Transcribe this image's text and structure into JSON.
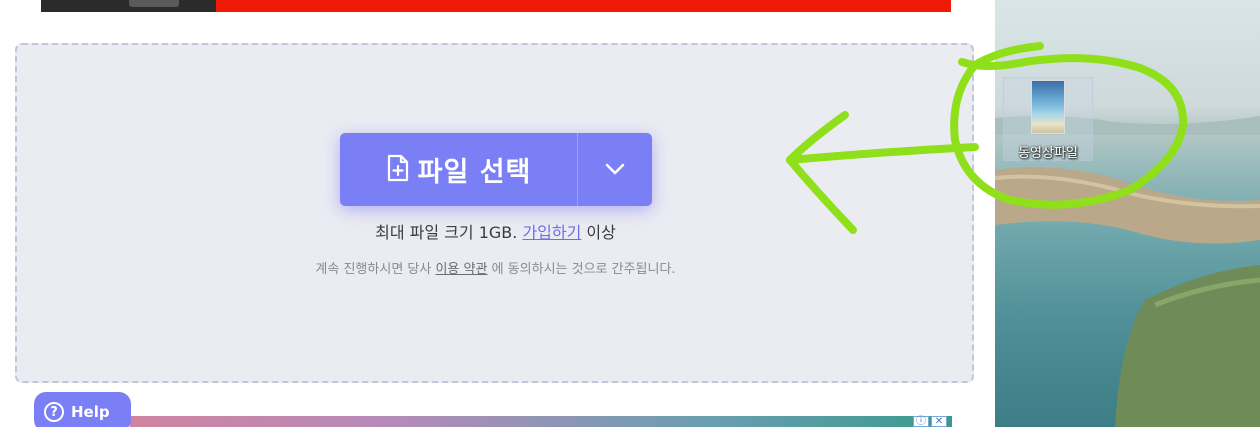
{
  "upload": {
    "choose_label": "파일 선택",
    "size_prefix": "최대 파일 크기 1GB.",
    "signup_link": "가입하기",
    "size_suffix": "이상",
    "terms_prefix": "계속 진행하시면 당사",
    "terms_link": "이용 약관",
    "terms_suffix": "에 동의하시는 것으로 간주됩니다."
  },
  "help": {
    "label": "Help",
    "icon_glyph": "?"
  },
  "ad": {
    "info_glyph": "ⓘ",
    "close_glyph": "✕"
  },
  "desktop": {
    "file_icon_label": "동영상파일"
  },
  "colors": {
    "accent": "#7a7ff5",
    "annotation": "#8fe01a",
    "banner_red": "#ee1a06",
    "zone_bg": "#ebebf2"
  }
}
